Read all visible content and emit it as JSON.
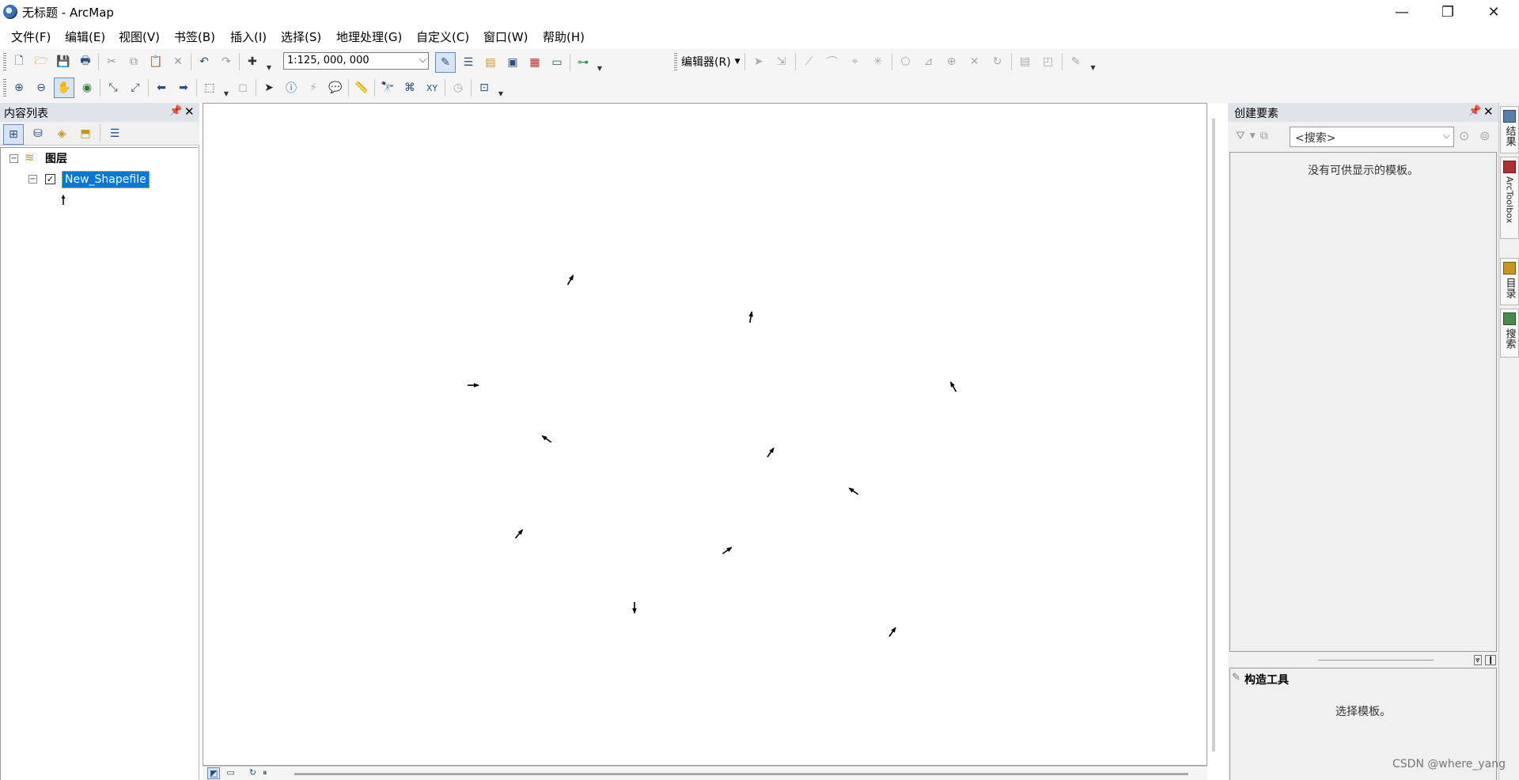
{
  "window": {
    "title": "无标题 - ArcMap",
    "minimize": "—",
    "restore": "❐",
    "close": "✕"
  },
  "menu": [
    "文件(F)",
    "编辑(E)",
    "视图(V)",
    "书签(B)",
    "插入(I)",
    "选择(S)",
    "地理处理(G)",
    "自定义(C)",
    "窗口(W)",
    "帮助(H)"
  ],
  "toolbar": {
    "scale": "1:125, 000, 000",
    "editor_label": "编辑器(R)"
  },
  "toc": {
    "title": "内容列表",
    "group_label": "图层",
    "layer_name": "New_Shapefile",
    "layer_checked": true
  },
  "right_panel": {
    "title": "创建要素",
    "search_placeholder": "<搜索>",
    "empty_message": "没有可供显示的模板。",
    "construct_title": "构造工具",
    "construct_message": "选择模板。"
  },
  "side_tabs": [
    "结果",
    "ArcToolbox",
    "目录",
    "搜索"
  ],
  "watermark": "CSDN @where_yang",
  "colors": {
    "selection": "#0078d7",
    "panel_header": "#dfe3ea"
  }
}
